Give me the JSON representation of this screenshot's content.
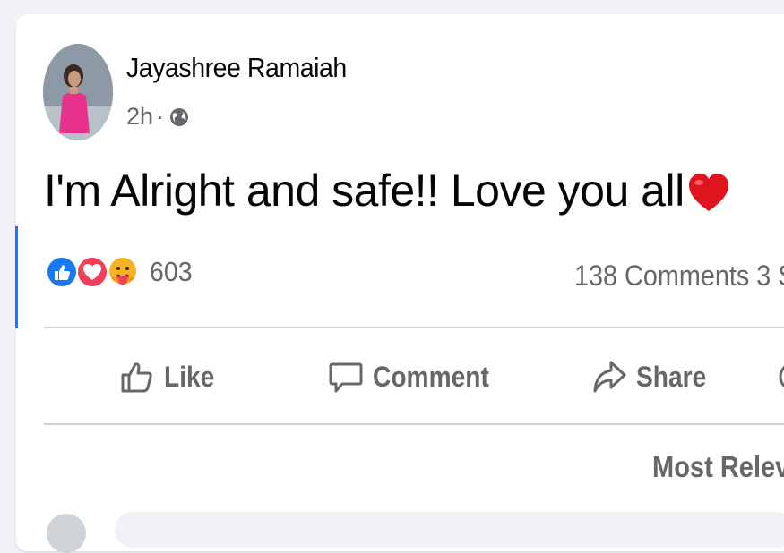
{
  "post": {
    "author": "Jayashree Ramaiah",
    "time": "2h",
    "separator": "·",
    "privacy_icon": "globe-icon",
    "text": "I'm Alright and safe!! Love you all",
    "text_emoji": "red-heart-icon"
  },
  "reactions": {
    "icons": [
      "like-reaction-icon",
      "love-reaction-icon",
      "care-reaction-icon"
    ],
    "count": "603"
  },
  "stats": {
    "comments_shares": "138 Comments  3 S"
  },
  "actions": {
    "like_label": "Like",
    "comment_label": "Comment",
    "share_label": "Share"
  },
  "comments": {
    "sort_label": "Most Releva"
  },
  "colors": {
    "accent": "#1877f2",
    "love": "#f33e58",
    "care": "#f7b125",
    "secondary_text": "#65676b",
    "primary_text": "#050505"
  }
}
